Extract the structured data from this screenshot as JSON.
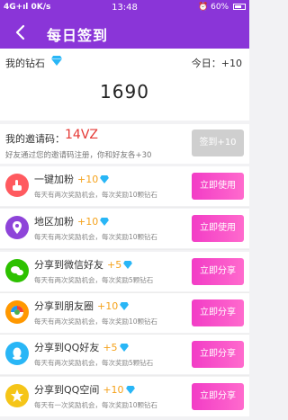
{
  "status_bar": {
    "network": "4G+ıl 0K/s",
    "time": "13:48",
    "right": "60%"
  },
  "header": {
    "title": "每日签到"
  },
  "points_card": {
    "label": "我的钻石",
    "today_label": "今日：+10",
    "total": "1690"
  },
  "invite": {
    "label": "我的邀请码：",
    "code": "14VZ",
    "hint": "好友通过您的邀请码注册，你和好友各+30",
    "button_label": "签到+10"
  },
  "tasks": [
    {
      "name": "一键加粉",
      "points": "+10",
      "desc": "每天有两次奖励机会，每次奖励10颗钻石",
      "button": "立即使用",
      "icon_color": "#ff5a5f"
    },
    {
      "name": "地区加粉",
      "points": "+10",
      "desc": "每天有两次奖励机会，每次奖励10颗钻石",
      "button": "立即使用",
      "icon_color": "#8e44d9"
    },
    {
      "name": "分享到微信好友",
      "points": "+5",
      "desc": "每天有两次奖励机会，每次奖励5颗钻石",
      "button": "立即分享",
      "icon_color": "#2dc100"
    },
    {
      "name": "分享到朋友圈",
      "points": "+10",
      "desc": "每天有两次奖励机会，每次奖励10颗钻石",
      "button": "立即分享",
      "icon_color": "#ff9800"
    },
    {
      "name": "分享到QQ好友",
      "points": "+5",
      "desc": "每天有两次奖励机会，每次奖励5颗钻石",
      "button": "立即分享",
      "icon_color": "#29b6f6"
    },
    {
      "name": "分享到QQ空间",
      "points": "+10",
      "desc": "每天有一次奖励机会，每次奖励10颗钻石",
      "button": "立即分享",
      "icon_color": "#f5c518"
    }
  ]
}
